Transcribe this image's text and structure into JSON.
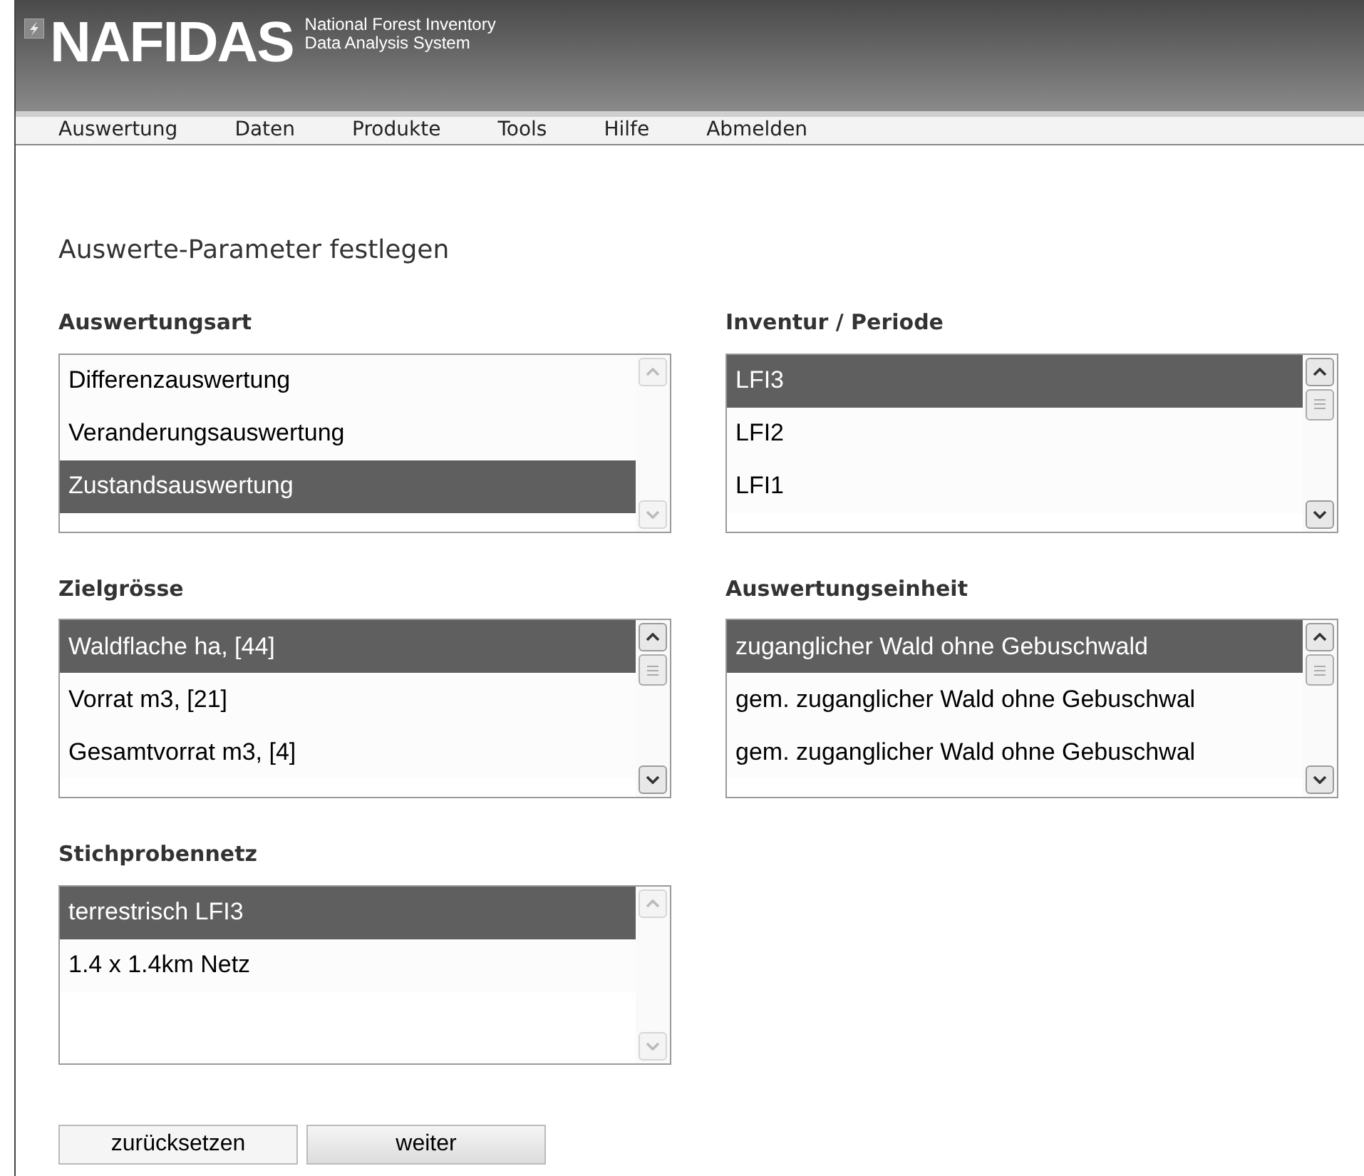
{
  "header": {
    "logo": "NAFIDAS",
    "subtitle_line_1": "National Forest Inventory",
    "subtitle_line_2": "Data Analysis System"
  },
  "menu": [
    "Auswertung",
    "Daten",
    "Produkte",
    "Tools",
    "Hilfe",
    "Abmelden"
  ],
  "page_title": "Auswerte-Parameter festlegen",
  "lists": [
    {
      "label": "Auswertungsart",
      "scrollbar_enabled": false,
      "items": [
        {
          "text": "Differenzauswertung",
          "selected": false
        },
        {
          "text": "Veranderungsauswertung",
          "selected": false
        },
        {
          "text": "Zustandsauswertung",
          "selected": true
        }
      ]
    },
    {
      "label": "Inventur / Periode",
      "scrollbar_enabled": true,
      "items": [
        {
          "text": "LFI3",
          "selected": true
        },
        {
          "text": "LFI2",
          "selected": false
        },
        {
          "text": "LFI1",
          "selected": false
        }
      ]
    },
    {
      "label": "Zielgrösse",
      "scrollbar_enabled": true,
      "items": [
        {
          "text": "Waldflache ha, [44]",
          "selected": true
        },
        {
          "text": "Vorrat m3, [21]",
          "selected": false
        },
        {
          "text": "Gesamtvorrat m3, [4]",
          "selected": false
        }
      ]
    },
    {
      "label": "Auswertungseinheit",
      "scrollbar_enabled": true,
      "items": [
        {
          "text": "zuganglicher Wald ohne Gebuschwald",
          "selected": true
        },
        {
          "text": "gem. zuganglicher Wald ohne Gebuschwal",
          "selected": false
        },
        {
          "text": "gem. zuganglicher Wald ohne Gebuschwal",
          "selected": false
        }
      ]
    },
    {
      "label": "Stichprobennetz",
      "scrollbar_enabled": false,
      "items": [
        {
          "text": "terrestrisch LFI3",
          "selected": true
        },
        {
          "text": "1.4 x 1.4km Netz",
          "selected": false
        }
      ]
    }
  ],
  "buttons": [
    "zurücksetzen",
    "weiter"
  ]
}
